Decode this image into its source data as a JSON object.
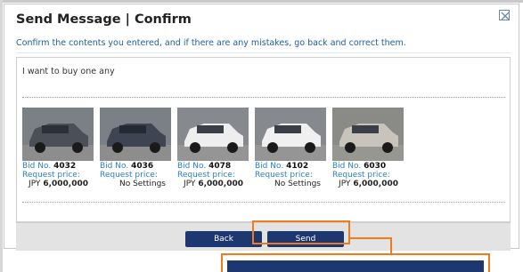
{
  "dialog": {
    "title": "Send Message | Confirm",
    "instructions": "Confirm the contents you entered, and if there are any mistakes, go back and correct them.",
    "message": "I want to buy one any"
  },
  "cars": [
    {
      "bid_label": "Bid No.",
      "bid_no": "4032",
      "request_label": "Request price:",
      "price_currency": "JPY",
      "price_value": "6,000,000",
      "price_text": "",
      "color": "#4a4f58"
    },
    {
      "bid_label": "Bid No.",
      "bid_no": "4036",
      "request_label": "Request price:",
      "price_currency": "",
      "price_value": "",
      "price_text": "No Settings",
      "color": "#3e4452"
    },
    {
      "bid_label": "Bid No.",
      "bid_no": "4078",
      "request_label": "Request price:",
      "price_currency": "JPY",
      "price_value": "6,000,000",
      "price_text": "",
      "color": "#eeeeee"
    },
    {
      "bid_label": "Bid No.",
      "bid_no": "4102",
      "request_label": "Request price:",
      "price_currency": "",
      "price_value": "",
      "price_text": "No Settings",
      "color": "#f0f0f0"
    },
    {
      "bid_label": "Bid No.",
      "bid_no": "6030",
      "request_label": "Request price:",
      "price_currency": "JPY",
      "price_value": "6,000,000",
      "price_text": "",
      "color": "#c9c4bb"
    }
  ],
  "buttons": {
    "back": "Back",
    "send": "Send"
  },
  "colors": {
    "accent": "#1d3770",
    "link_blue": "#2a7fc4",
    "highlight": "#f07a1c"
  }
}
